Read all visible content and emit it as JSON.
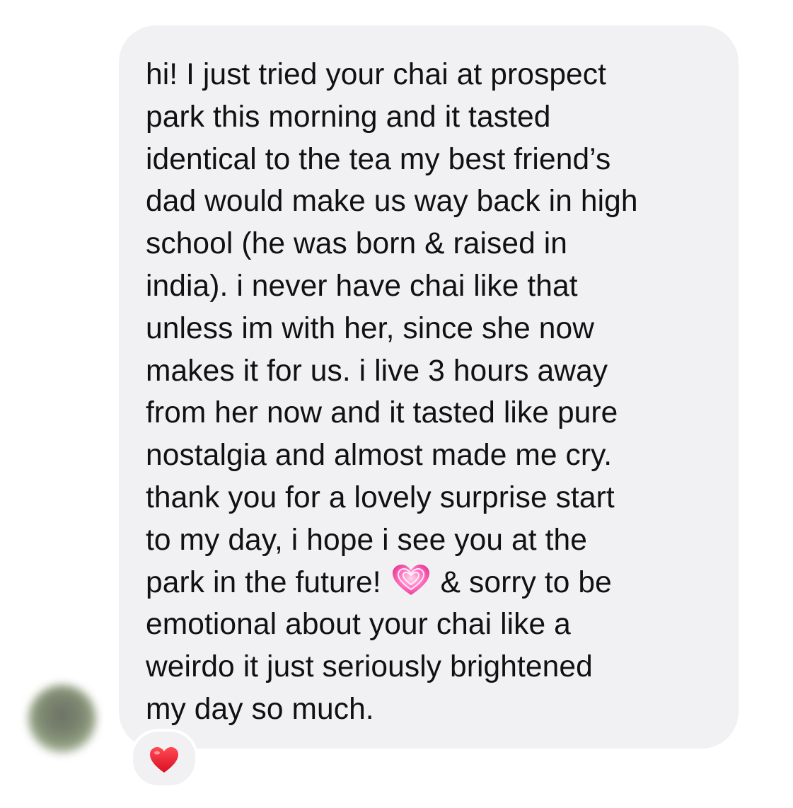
{
  "message": {
    "text_part_1": "hi! I just tried your chai at prospect\npark this morning and it tasted\nidentical to the tea my best friend’s\ndad would make us way back in high\nschool (he was born & raised in\nindia). i never have chai like that\nunless im with her, since she now\nmakes it for us. i live 3 hours away\nfrom her now and it tasted like pure\nnostalgia and almost made me cry.\nthank you for a lovely surprise start\nto my day, i hope i see you at the\npark in the future!",
    "emoji": "growing-heart-icon",
    "text_part_2": "& sorry to be\nemotional about your chai like a\nweirdo it just seriously brightened\nmy day so much.",
    "bubble_color": "#f1f1f3",
    "text_color": "#111111"
  },
  "reaction": {
    "icon": "red-heart-icon",
    "color": "#e0162b"
  },
  "avatar": {
    "icon": "blurred-profile-avatar"
  }
}
